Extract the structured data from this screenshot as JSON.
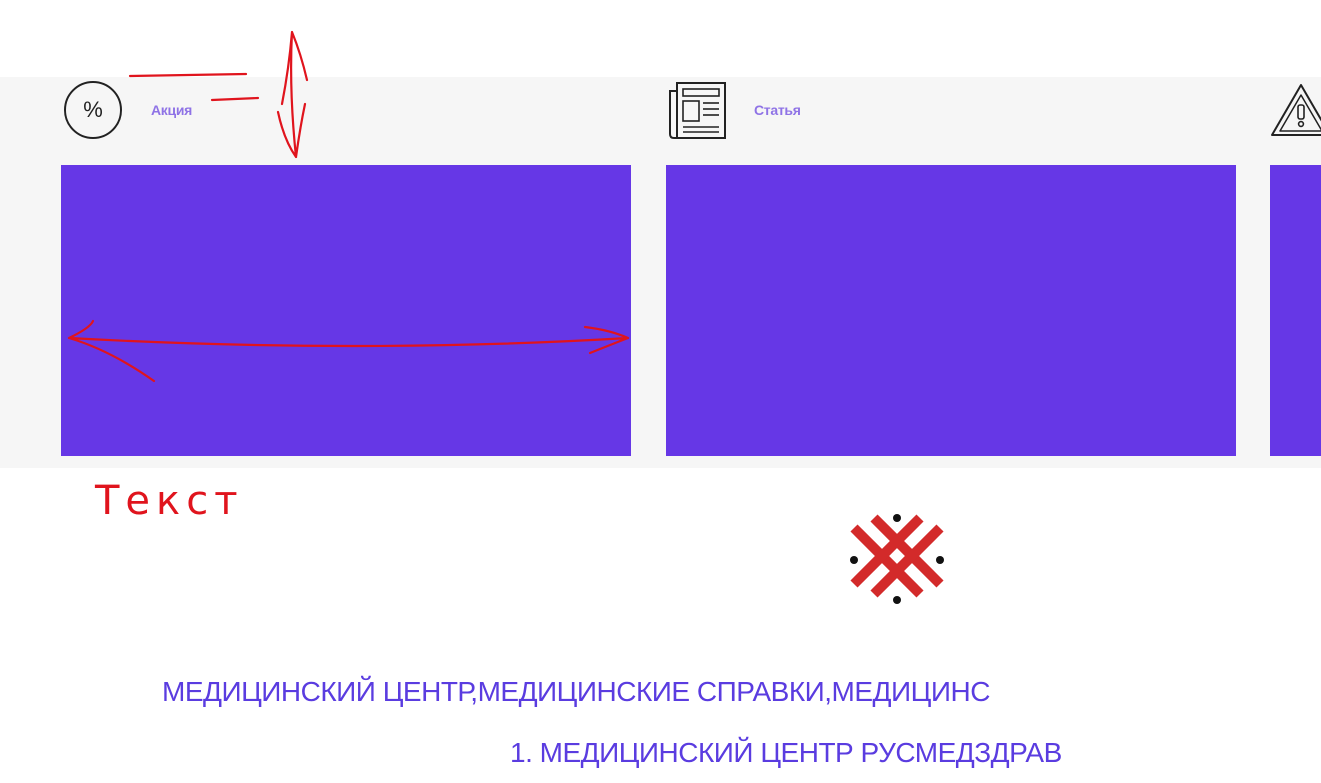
{
  "cards": [
    {
      "tag": "Акция",
      "icon": "percent-icon"
    },
    {
      "tag": "Статья",
      "icon": "newspaper-icon"
    },
    {
      "tag": "",
      "icon": "warning-icon"
    }
  ],
  "annotation": {
    "handwritten_label": "Текст"
  },
  "footer": {
    "title_line": "МЕДИЦИНСКИЙ ЦЕНТР,МЕДИЦИНСКИЕ СПРАВКИ,МЕДИЦИНС",
    "subtitle_line": "1. МЕДИЦИНСКИЙ ЦЕНТР РУСМЕДЗДРАВ"
  },
  "colors": {
    "accent": "#6637e6",
    "tag_text": "#8f73e6",
    "footer_text": "#5a3ce0",
    "band_background": "#f6f6f6",
    "annotation_red": "#e0141d",
    "logo_red": "#d32a2a"
  }
}
